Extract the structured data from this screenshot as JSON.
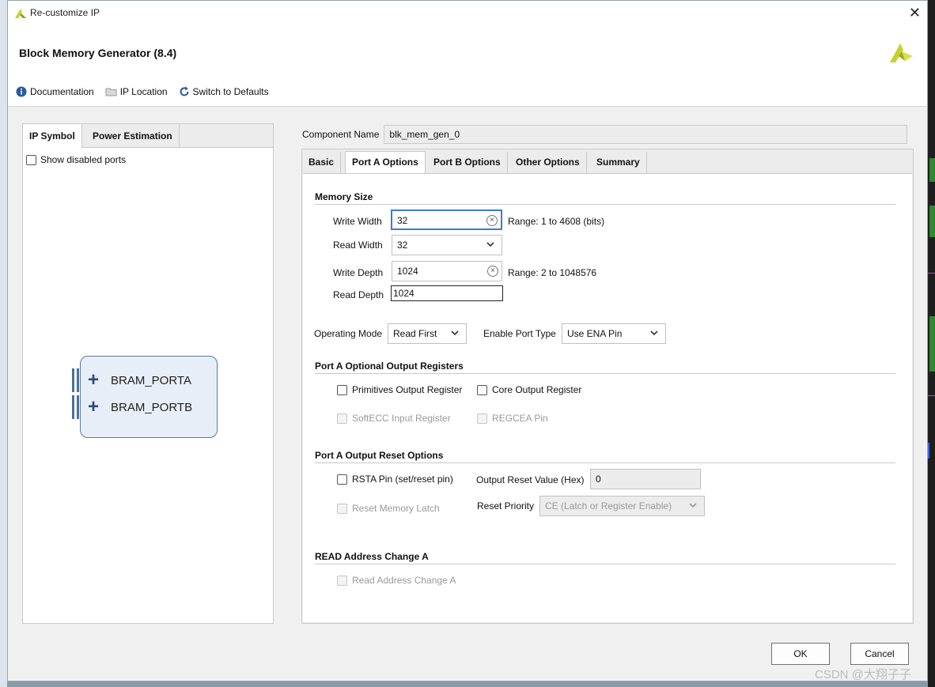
{
  "window": {
    "title": "Re-customize IP",
    "close_glyph": "✕"
  },
  "header": {
    "title": "Block Memory Generator (8.4)",
    "links": [
      {
        "label": "Documentation",
        "icon": "info-icon"
      },
      {
        "label": "IP Location",
        "icon": "folder-icon"
      },
      {
        "label": "Switch to Defaults",
        "icon": "refresh-icon"
      }
    ]
  },
  "left_panel": {
    "tabs": [
      "IP Symbol",
      "Power Estimation"
    ],
    "show_disabled_ports": "Show disabled ports",
    "ports": [
      "BRAM_PORTA",
      "BRAM_PORTB"
    ]
  },
  "component": {
    "label": "Component Name",
    "value": "blk_mem_gen_0"
  },
  "tabs": [
    "Basic",
    "Port A Options",
    "Port B Options",
    "Other Options",
    "Summary"
  ],
  "memory_size": {
    "title": "Memory Size",
    "write_width": {
      "label": "Write Width",
      "value": "32",
      "range": "Range: 1 to 4608 (bits)"
    },
    "read_width": {
      "label": "Read Width",
      "value": "32"
    },
    "write_depth": {
      "label": "Write Depth",
      "value": "1024",
      "range": "Range: 2 to 1048576"
    },
    "read_depth": {
      "label": "Read Depth",
      "value": "1024"
    }
  },
  "operating_mode": {
    "label": "Operating Mode",
    "value": "Read First"
  },
  "enable_port_type": {
    "label": "Enable Port Type",
    "value": "Use ENA Pin"
  },
  "optional_output_registers": {
    "title": "Port A Optional Output Registers",
    "primitives": "Primitives Output Register",
    "core": "Core Output Register",
    "softecc": "SoftECC Input Register",
    "regcea": "REGCEA Pin"
  },
  "output_reset": {
    "title": "Port A Output Reset Options",
    "rsta": "RSTA Pin (set/reset pin)",
    "reset_value_label": "Output Reset Value (Hex)",
    "reset_value": "0",
    "reset_memory_latch": "Reset Memory Latch",
    "reset_priority_label": "Reset Priority",
    "reset_priority_value": "CE (Latch or Register Enable)"
  },
  "read_address": {
    "title": "READ Address Change A",
    "checkbox": "Read Address Change A"
  },
  "buttons": {
    "ok": "OK",
    "cancel": "Cancel"
  },
  "watermark": "CSDN @大翔子子",
  "colors": {
    "accent": "#3a7bd5",
    "logo": "#c6d22c",
    "port_blue": "#4a6fa0"
  }
}
